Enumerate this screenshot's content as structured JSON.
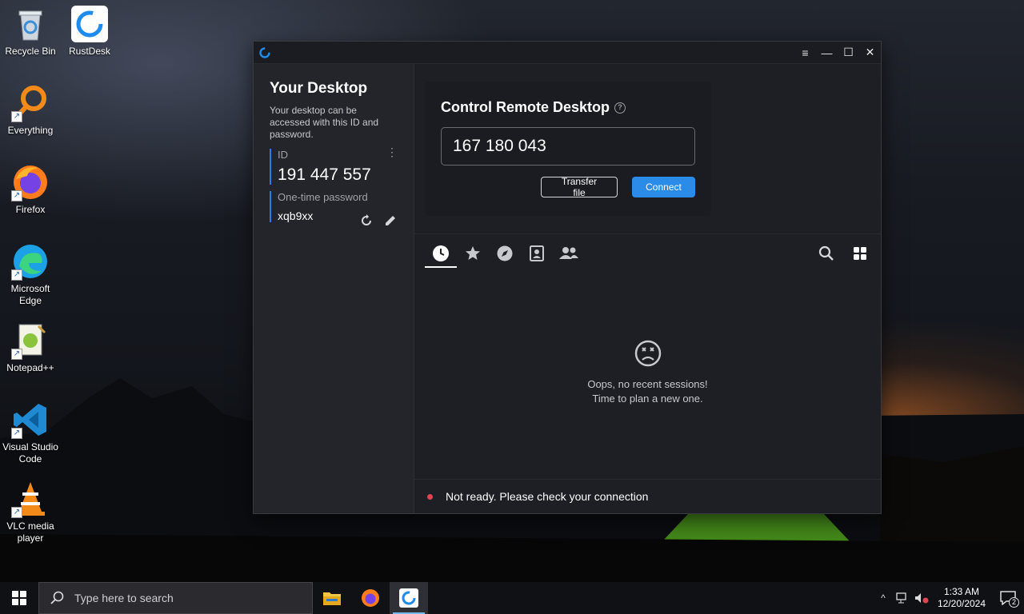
{
  "desktop": {
    "icons": [
      {
        "label": "Recycle Bin",
        "icon": "recycle-bin-icon"
      },
      {
        "label": "RustDesk",
        "icon": "rustdesk-icon"
      },
      {
        "label": "Everything",
        "icon": "everything-icon"
      },
      {
        "label": "Firefox",
        "icon": "firefox-icon"
      },
      {
        "label": "Microsoft Edge",
        "icon": "edge-icon"
      },
      {
        "label": "Notepad++",
        "icon": "notepadpp-icon"
      },
      {
        "label": "Visual Studio Code",
        "icon": "vscode-icon"
      },
      {
        "label": "VLC media player",
        "icon": "vlc-icon"
      }
    ]
  },
  "window": {
    "controls": {
      "menu": "≡",
      "minimize": "—",
      "maximize": "☐",
      "close": "✕"
    },
    "left": {
      "title": "Your Desktop",
      "description": "Your desktop can be accessed with this ID and password.",
      "id_label": "ID",
      "id_value": "191 447 557",
      "password_label": "One-time password",
      "password_value": "xqb9xx"
    },
    "connect": {
      "title": "Control Remote Desktop",
      "remote_id": "167 180 043",
      "transfer_label": "Transfer file",
      "connect_label": "Connect"
    },
    "tabs": [
      {
        "name": "recent",
        "icon": "clock-icon",
        "active": true
      },
      {
        "name": "favorites",
        "icon": "star-icon"
      },
      {
        "name": "discovered",
        "icon": "compass-icon"
      },
      {
        "name": "address-book",
        "icon": "contact-book-icon"
      },
      {
        "name": "group",
        "icon": "people-icon"
      }
    ],
    "empty": {
      "line1": "Oops, no recent sessions!",
      "line2": "Time to plan a new one."
    },
    "status": "Not ready. Please check your connection"
  },
  "taskbar": {
    "search_placeholder": "Type here to search",
    "time": "1:33 AM",
    "date": "12/20/2024",
    "notification_count": "2"
  },
  "colors": {
    "accent": "#2a8be9",
    "status_error": "#e04452",
    "window_bg": "#1e1f25",
    "sidebar_bg": "#24252b"
  }
}
